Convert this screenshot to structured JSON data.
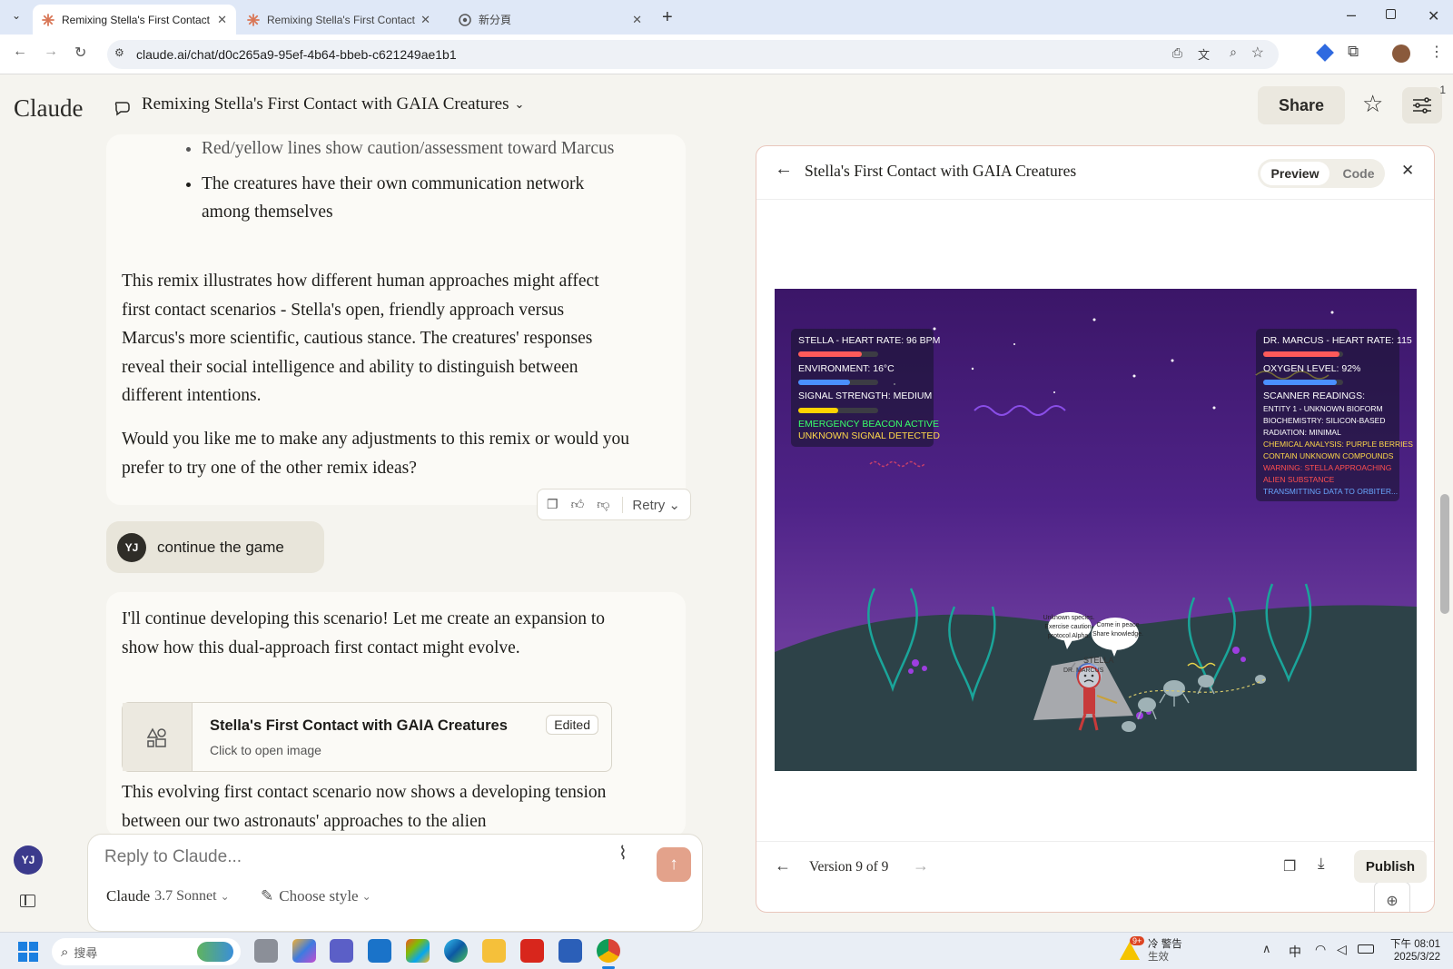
{
  "browser": {
    "tabs": [
      {
        "title": "Remixing Stella's First Contact"
      },
      {
        "title": "Remixing Stella's First Contact"
      },
      {
        "title": "新分頁"
      }
    ],
    "url": "claude.ai/chat/d0c265a9-95ef-4b64-bbeb-c621249ae1b1"
  },
  "header": {
    "logo": "Claude",
    "chat_title": "Remixing Stella's First Contact with GAIA Creatures",
    "share_label": "Share",
    "notification_count": "1"
  },
  "chat": {
    "bullets": [
      "Red/yellow lines show caution/assessment toward Marcus",
      "The creatures have their own communication network among themselves"
    ],
    "para1": "This remix illustrates how different human approaches might affect first contact scenarios - Stella's open, friendly approach versus Marcus's more scientific, cautious stance. The creatures' responses reveal their social intelligence and ability to distinguish between different intentions.",
    "para2": "Would you like me to make any adjustments to this remix or would you prefer to try one of the other remix ideas?",
    "retry_label": "Retry",
    "user_initials": "YJ",
    "user_message": "continue the game",
    "reply_intro": "I'll continue developing this scenario! Let me create an expansion to show how this dual-approach first contact might evolve.",
    "artifact_card": {
      "title": "Stella's First Contact with GAIA Creatures",
      "subtitle": "Click to open image",
      "badge": "Edited"
    },
    "reply_tail": "This evolving first contact scenario now shows a developing tension between our two astronauts' approaches to the alien"
  },
  "composer": {
    "placeholder": "Reply to Claude...",
    "model_brand": "Claude",
    "model_version": "3.7 Sonnet",
    "style_label": "Choose style"
  },
  "sidebar": {
    "user_initials": "YJ"
  },
  "artifact": {
    "title": "Stella's First Contact with GAIA Creatures",
    "preview_label": "Preview",
    "code_label": "Code",
    "version_label": "Version 9 of 9",
    "publish_label": "Publish"
  },
  "game": {
    "hud_left": {
      "heart_rate": "STELLA - HEART RATE: 96 BPM",
      "heart_level": 0.8,
      "environment": "ENVIRONMENT: 16°C",
      "env_level": 0.65,
      "signal": "SIGNAL STRENGTH: MEDIUM",
      "signal_level": 0.5,
      "beacon": "EMERGENCY BEACON ACTIVE",
      "unknown_signal": "UNKNOWN SIGNAL DETECTED"
    },
    "hud_right": {
      "heart_rate": "DR. MARCUS - HEART RATE: 115",
      "heart_level": 0.95,
      "oxygen": "OXYGEN LEVEL: 92%",
      "oxygen_level": 0.92,
      "scanner_title": "SCANNER READINGS:",
      "entity": "ENTITY 1 - UNKNOWN BIOFORM",
      "biochem": "BIOCHEMISTRY: SILICON-BASED",
      "radiation": "RADIATION: MINIMAL",
      "chem1": "CHEMICAL ANALYSIS: PURPLE BERRIES",
      "chem2": "CONTAIN UNKNOWN COMPOUNDS",
      "warn1": "WARNING: STELLA APPROACHING",
      "warn2": "ALIEN SUBSTANCE",
      "transmit": "TRANSMITTING DATA TO ORBITER..."
    },
    "speech_left": [
      "Unknown species.",
      "Exercise caution.",
      "protocol Alpha."
    ],
    "speech_right": [
      "Come in peace",
      "Share knowledge."
    ],
    "ship_label": "STELLA",
    "ship_label2": "DR. MARCUS"
  },
  "taskbar": {
    "search_placeholder": "搜尋",
    "weather_badge": "9+",
    "weather_line1": "冷 警告",
    "weather_line2": "生效",
    "ime": "中",
    "time": "下午 08:01",
    "date": "2025/3/22"
  },
  "colors": {
    "accent": "#d97757",
    "panel_border": "#e9c6bc",
    "heart_bar": "#ff5a5a",
    "env_bar": "#4a90ff",
    "signal_bar": "#ffd400",
    "beacon_text": "#39ff6a",
    "warning_text": "#ff4f4f",
    "chem_text": "#ffd84a",
    "transmit_text": "#69a8ff"
  }
}
